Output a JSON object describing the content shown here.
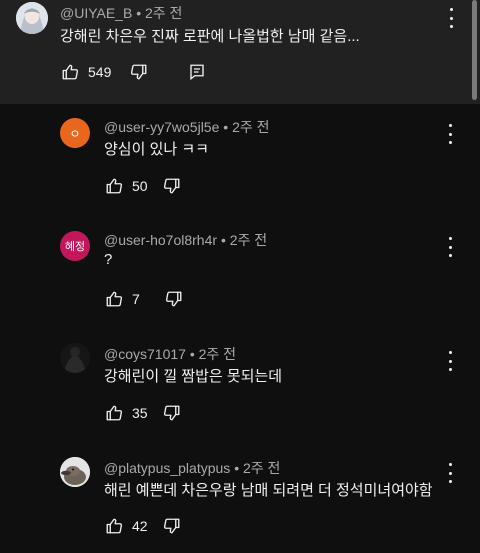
{
  "parent_comment": {
    "author": "@UIYAE_B",
    "time": "2주 전",
    "text": "강해린 차은우 진짜 로판에 나올법한 남매 같음...",
    "likes": "549",
    "icons": [
      "thumb-up-icon",
      "thumb-down-icon",
      "reply-count-icon",
      "more-vert-icon"
    ]
  },
  "replies": [
    {
      "author": "@user-yy7wo5jl5e",
      "time": "2주 전",
      "text": "양심이 있나 ㅋㅋ",
      "likes": "50",
      "avatar_text": "ㅇ",
      "avatar_color": "#e8671c"
    },
    {
      "author": "@user-ho7ol8rh4r",
      "time": "2주 전",
      "text": "?",
      "likes": "7",
      "avatar_text": "혜정",
      "avatar_color": "#c2185b"
    },
    {
      "author": "@coys71017",
      "time": "2주 전",
      "text": "강해린이 낄 짬밥은 못되는데",
      "likes": "35",
      "avatar_text": "",
      "avatar_color": "#1c1c1c"
    },
    {
      "author": "@platypus_platypus",
      "time": "2주 전",
      "text": "해린 예쁜데 차은우랑 남매 되려면 더 정석미녀여야함",
      "likes": "42",
      "avatar_text": "",
      "avatar_color": "#d8d8d8"
    }
  ]
}
